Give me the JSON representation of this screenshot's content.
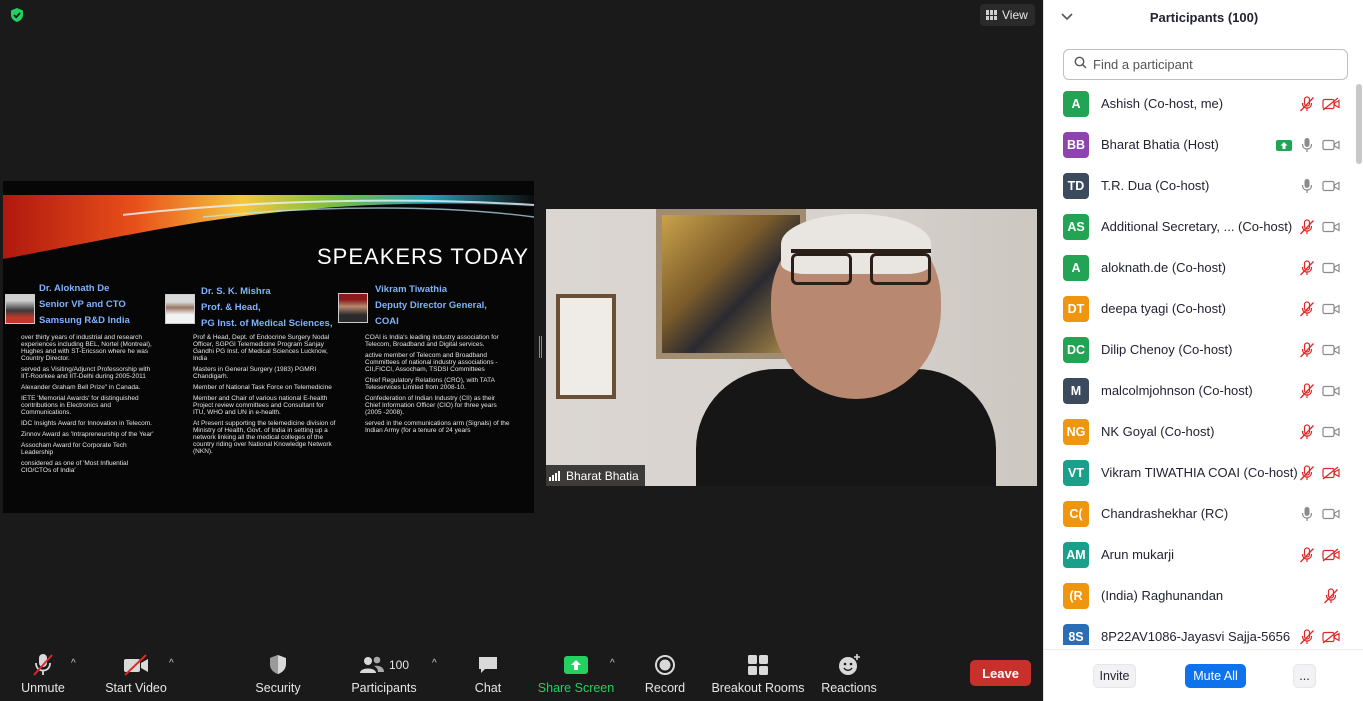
{
  "meeting": {
    "view_label": "View",
    "slide": {
      "title": "SPEAKERS TODAY",
      "speakers": [
        {
          "name_lines": [
            "Dr. Aloknath De",
            "Senior VP and CTO",
            "Samsung R&D India"
          ],
          "lines": [
            "over thirty years of industrial and research experiences including BEL, Nortel (Montreal), Hughes and with ST-Ericsson where he was Country Director.",
            "served as Visiting/Adjunct Professorship with IIT-Roorkee and IIT-Delhi during 2005-2011",
            "Alexander Graham Bell Prize\" in Canada.",
            "IETE 'Memorial Awards' for distinguished contributions in Electronics and Communications.",
            "IDC Insights Award for Innovation in Telecom.",
            "Zinnov Award as 'Intrapreneurship of the Year'",
            "Assocham Award for Corporate Tech Leadership",
            "considered as one of 'Most Influential CIO/CTOs of India'"
          ]
        },
        {
          "name_lines": [
            "Dr. S. K. Mishra",
            "Prof. & Head,",
            "PG Inst. of Medical Sciences,"
          ],
          "lines": [
            "Prof & Head, Dept. of Endocrine Surgery Nodal Officer, SGPGI Telemedicine Program Sanjay Gandhi PG Inst. of Medical Sciences Lucknow, India",
            "Masters in General Surgery (1983) PGMRI Chandigarh.",
            "Member of National Task Force on Telemedicine",
            "Member and Chair of various national E-health Project review committees and Consultant for ITU, WHO and UN in e-health.",
            "At Present supporting the telemedicine division of Ministry of Health, Govt. of India in setting up a network linking all the medical colleges of the country riding over National Knowledge Network (NKN)."
          ]
        },
        {
          "name_lines": [
            "Vikram Tiwathia",
            "Deputy Director General,",
            "COAI"
          ],
          "lines": [
            "COAI is India's leading industry association for Telecom, Broadband and Digital services.",
            "active member of Telecom and Broadband Committees of national industry associations - CII,FICCI, Assocham, TSDSI Committees",
            "Chief Regulatory Relations (CRO), with TATA Teleservices Limited from 2008-10.",
            "Confederation of Indian Industry (CII) as their Chief Information Officer (CIO) for three years (2005 -2008).",
            "served in the communications arm (Signals) of the Indian Army (for a tenure of 24 years"
          ]
        }
      ]
    },
    "video_name": "Bharat Bhatia"
  },
  "toolbar": {
    "unmute": "Unmute",
    "start_video": "Start Video",
    "security": "Security",
    "participants": "Participants",
    "participants_count": "100",
    "chat": "Chat",
    "share_screen": "Share Screen",
    "record": "Record",
    "breakout_rooms": "Breakout Rooms",
    "reactions": "Reactions",
    "leave": "Leave"
  },
  "panel": {
    "title": "Participants (100)",
    "search_placeholder": "Find a participant",
    "invite": "Invite",
    "mute_all": "Mute All",
    "more": "...",
    "participants": [
      {
        "initials": "A",
        "color": "#23a455",
        "name": "Ashish (Co-host, me)",
        "mic": "muted",
        "video": "off"
      },
      {
        "initials": "BB",
        "color": "#8e44ad",
        "name": "Bharat Bhatia (Host)",
        "mic": "on",
        "video": "on",
        "sharing": true
      },
      {
        "initials": "TD",
        "color": "#3b4a5c",
        "name": "T.R. Dua (Co-host)",
        "mic": "on",
        "video": "on"
      },
      {
        "initials": "AS",
        "color": "#23a455",
        "name": "Additional Secretary, ...  (Co-host)",
        "mic": "muted",
        "video": "on"
      },
      {
        "initials": "A",
        "color": "#23a455",
        "name": "aloknath.de (Co-host)",
        "mic": "muted",
        "video": "on"
      },
      {
        "initials": "DT",
        "color": "#f0960e",
        "name": "deepa tyagi (Co-host)",
        "mic": "muted",
        "video": "on"
      },
      {
        "initials": "DC",
        "color": "#23a455",
        "name": "Dilip Chenoy (Co-host)",
        "mic": "muted",
        "video": "on"
      },
      {
        "initials": "M",
        "color": "#3b4a5c",
        "name": "malcolmjohnson (Co-host)",
        "mic": "muted",
        "video": "on"
      },
      {
        "initials": "NG",
        "color": "#f0960e",
        "name": "NK Goyal (Co-host)",
        "mic": "muted",
        "video": "on"
      },
      {
        "initials": "VT",
        "color": "#1a9f8a",
        "name": "Vikram TIWATHIA COAI (Co-host)",
        "mic": "muted",
        "video": "off"
      },
      {
        "initials": "C(",
        "color": "#f0960e",
        "name": "Chandrashekhar (RC)",
        "mic": "on",
        "video": "on"
      },
      {
        "initials": "AM",
        "color": "#1a9f8a",
        "name": "Arun mukarji",
        "mic": "muted",
        "video": "off"
      },
      {
        "initials": "(R",
        "color": "#f0960e",
        "name": "(India) Raghunandan",
        "mic": "muted",
        "video": "none"
      },
      {
        "initials": "8S",
        "color": "#2a6fb5",
        "name": "8P22AV1086-Jayasvi Sajja-5656",
        "mic": "muted",
        "video": "off"
      }
    ]
  }
}
